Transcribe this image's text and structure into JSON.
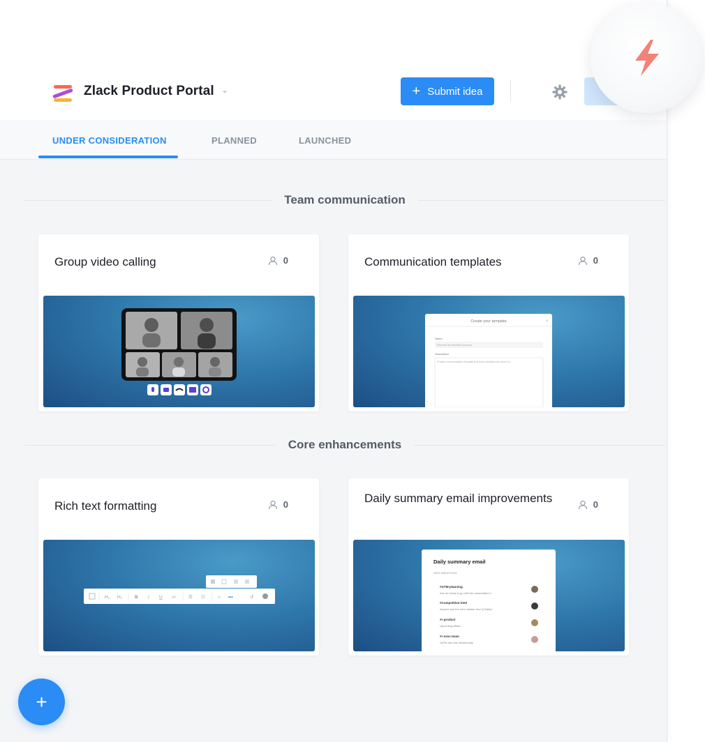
{
  "header": {
    "title": "Zlack Product Portal",
    "submit_label": "Submit idea",
    "accent": "#2a8cf4"
  },
  "tabs": [
    {
      "label": "UNDER CONSIDERATION",
      "active": true
    },
    {
      "label": "PLANNED",
      "active": false
    },
    {
      "label": "LAUNCHED",
      "active": false
    }
  ],
  "sections": [
    {
      "title": "Team communication",
      "cards": [
        {
          "title": "Group video calling",
          "votes": "0"
        },
        {
          "title": "Communication templates",
          "votes": "0",
          "preview": {
            "heading": "Create your template",
            "name_label": "Name",
            "name_placeholder": "Describe the template's purpose",
            "desc_label": "Description",
            "desc_placeholder": "Create a communication template that team members can reuse for..."
          }
        }
      ]
    },
    {
      "title": "Core enhancements",
      "cards": [
        {
          "title": "Rich text formatting",
          "votes": "0"
        },
        {
          "title": "Daily summary email improvements",
          "votes": "0",
          "preview": {
            "heading": "Daily summary email",
            "subheading": "NEW #MENTIONS",
            "items": [
              {
                "channel": "#GTM-planning",
                "text": "Are we ready to go with the presentation?"
              },
              {
                "channel": "#Competitive-intel",
                "text": "Anyone see the new release from (Chatty?"
              },
              {
                "channel": "#r-product",
                "text": "Upcoming offsite"
              },
              {
                "channel": "#r-exec-team",
                "text": "OKRs due this Wednesday"
              }
            ]
          }
        }
      ]
    }
  ],
  "icons": {
    "bolt": "lightning-bolt-icon",
    "gear": "gear-icon",
    "votes": "user-icon",
    "fab": "plus-icon"
  },
  "fab_label": "+"
}
